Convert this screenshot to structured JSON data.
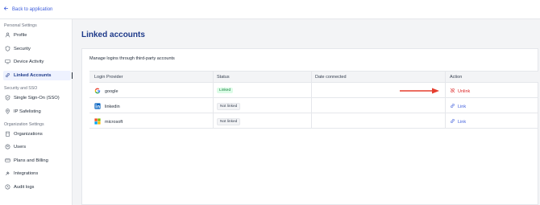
{
  "topbar": {
    "back_label": "Back to application"
  },
  "sidebar": {
    "sections": [
      {
        "title": "Personal Settings"
      },
      {
        "title": "Security and SSO"
      },
      {
        "title": "Organization Settings"
      }
    ],
    "items": [
      {
        "label": "Profile",
        "icon": "user-icon"
      },
      {
        "label": "Security",
        "icon": "shield-icon"
      },
      {
        "label": "Device Activity",
        "icon": "device-icon"
      },
      {
        "label": "Linked Accounts",
        "icon": "link-icon",
        "active": true
      },
      {
        "label": "Single Sign-On (SSO)",
        "icon": "shield-check-icon"
      },
      {
        "label": "IP Safelisting",
        "icon": "location-icon"
      },
      {
        "label": "Organizations",
        "icon": "building-icon"
      },
      {
        "label": "Users",
        "icon": "users-icon"
      },
      {
        "label": "Plans and Billing",
        "icon": "card-icon"
      },
      {
        "label": "Integrations",
        "icon": "plug-icon"
      },
      {
        "label": "Audit logs",
        "icon": "clock-icon"
      }
    ]
  },
  "main": {
    "title": "Linked accounts",
    "description": "Manage logins through third-party accounts",
    "columns": [
      "Login Provider",
      "Status",
      "Date connected",
      "Action"
    ],
    "rows": [
      {
        "provider": "google",
        "status": "Linked",
        "date": "",
        "action": "Unlink"
      },
      {
        "provider": "linkedin",
        "status": "Not linked",
        "date": "",
        "action": "Link"
      },
      {
        "provider": "microsoft",
        "status": "Not linked",
        "date": "",
        "action": "Link"
      }
    ]
  },
  "colors": {
    "accent": "#3b5bdb",
    "title": "#1e3a8a",
    "unlink": "#dc2626",
    "arrow": "#e53e2f",
    "linked_badge": "#15803d"
  }
}
